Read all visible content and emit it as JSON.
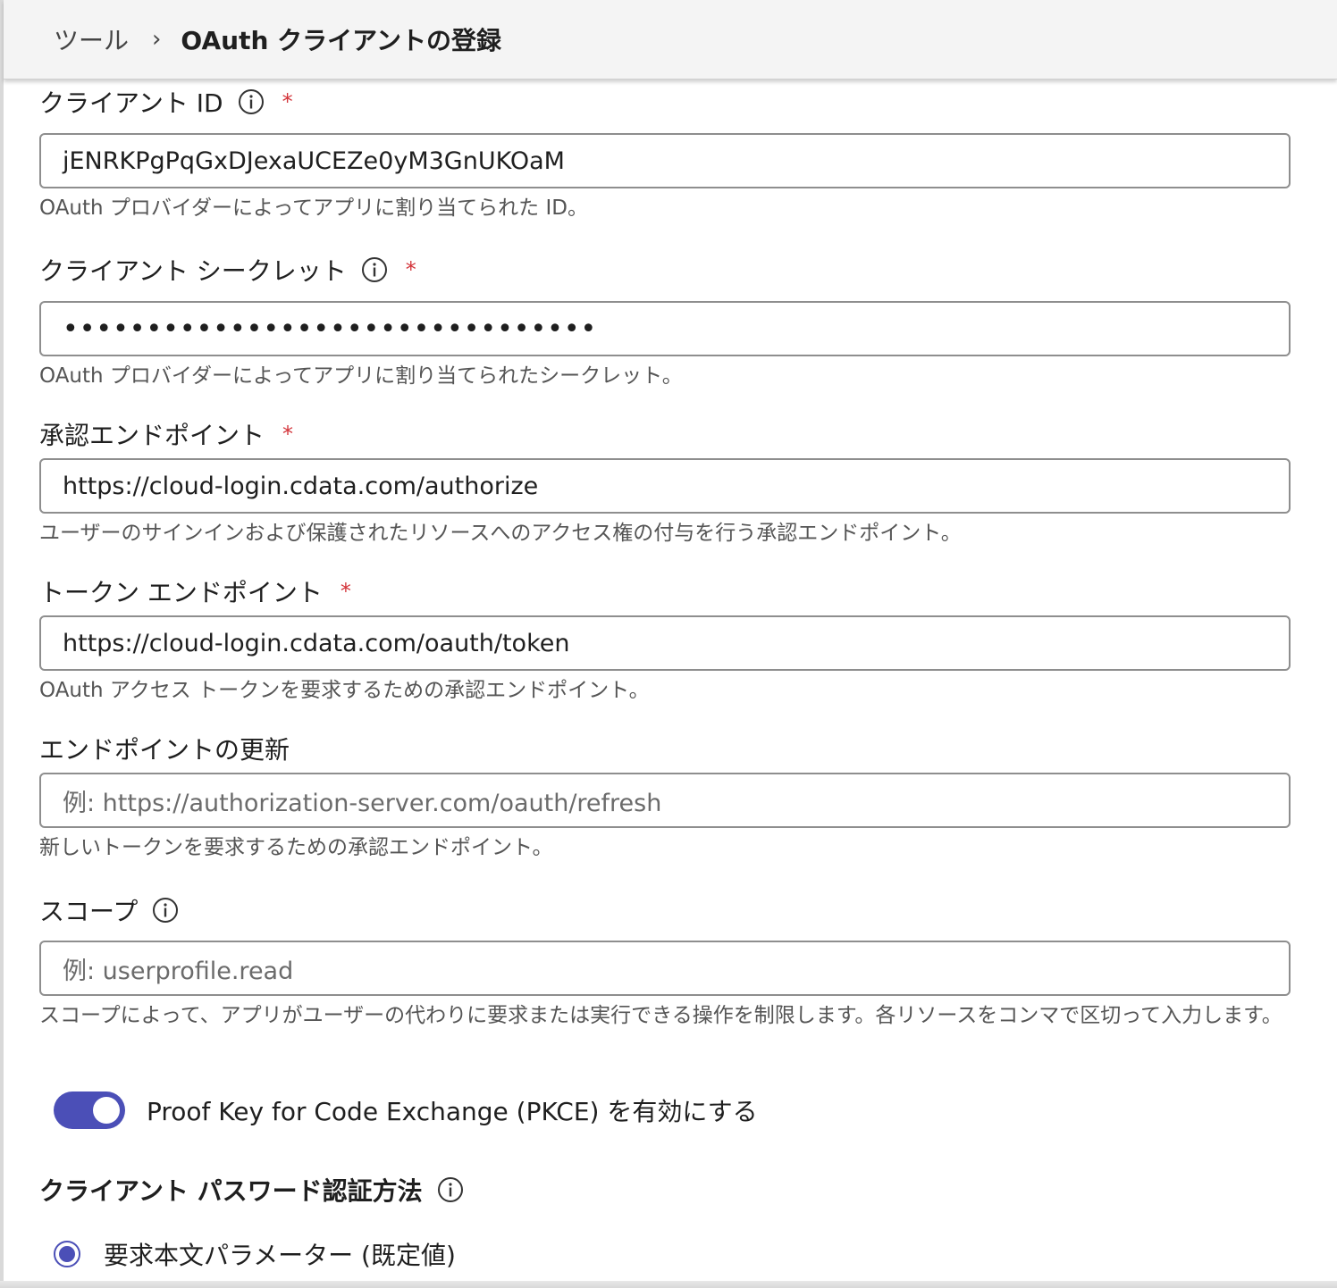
{
  "breadcrumb": {
    "root": "ツール",
    "separator": "›",
    "current": "OAuth クライアントの登録"
  },
  "fields": {
    "client_id": {
      "label": "クライアント ID",
      "required": "*",
      "value": "jENRKPgPqGxDJexaUCEZe0yM3GnUKOaM",
      "help": "OAuth プロバイダーによってアプリに割り当てられた ID。"
    },
    "client_secret": {
      "label": "クライアント シークレット",
      "required": "*",
      "value": "••••••••••••••••••••••••••••••••",
      "help": "OAuth プロバイダーによってアプリに割り当てられたシークレット。"
    },
    "auth_endpoint": {
      "label": "承認エンドポイント",
      "required": "*",
      "value": "https://cloud-login.cdata.com/authorize",
      "help": "ユーザーのサインインおよび保護されたリソースへのアクセス権の付与を行う承認エンドポイント。"
    },
    "token_endpoint": {
      "label": "トークン エンドポイント",
      "required": "*",
      "value": "https://cloud-login.cdata.com/oauth/token",
      "help": "OAuth アクセス トークンを要求するための承認エンドポイント。"
    },
    "refresh_endpoint": {
      "label": "エンドポイントの更新",
      "placeholder": "例: https://authorization-server.com/oauth/refresh",
      "help": "新しいトークンを要求するための承認エンドポイント。"
    },
    "scope": {
      "label": "スコープ",
      "placeholder": "例: userprofile.read",
      "help": "スコープによって、アプリがユーザーの代わりに要求または実行できる操作を制限します。各リソースをコンマで区切って入力します。"
    }
  },
  "pkce": {
    "label": "Proof Key for Code Exchange (PKCE) を有効にする",
    "enabled": true
  },
  "auth_method": {
    "label": "クライアント パスワード認証方法",
    "selected_option": "要求本文パラメーター (既定値)"
  },
  "colors": {
    "accent": "#4b4fb7",
    "required": "#d3343a",
    "border": "#8e8e8e",
    "header_bg": "#f4f4f4"
  }
}
